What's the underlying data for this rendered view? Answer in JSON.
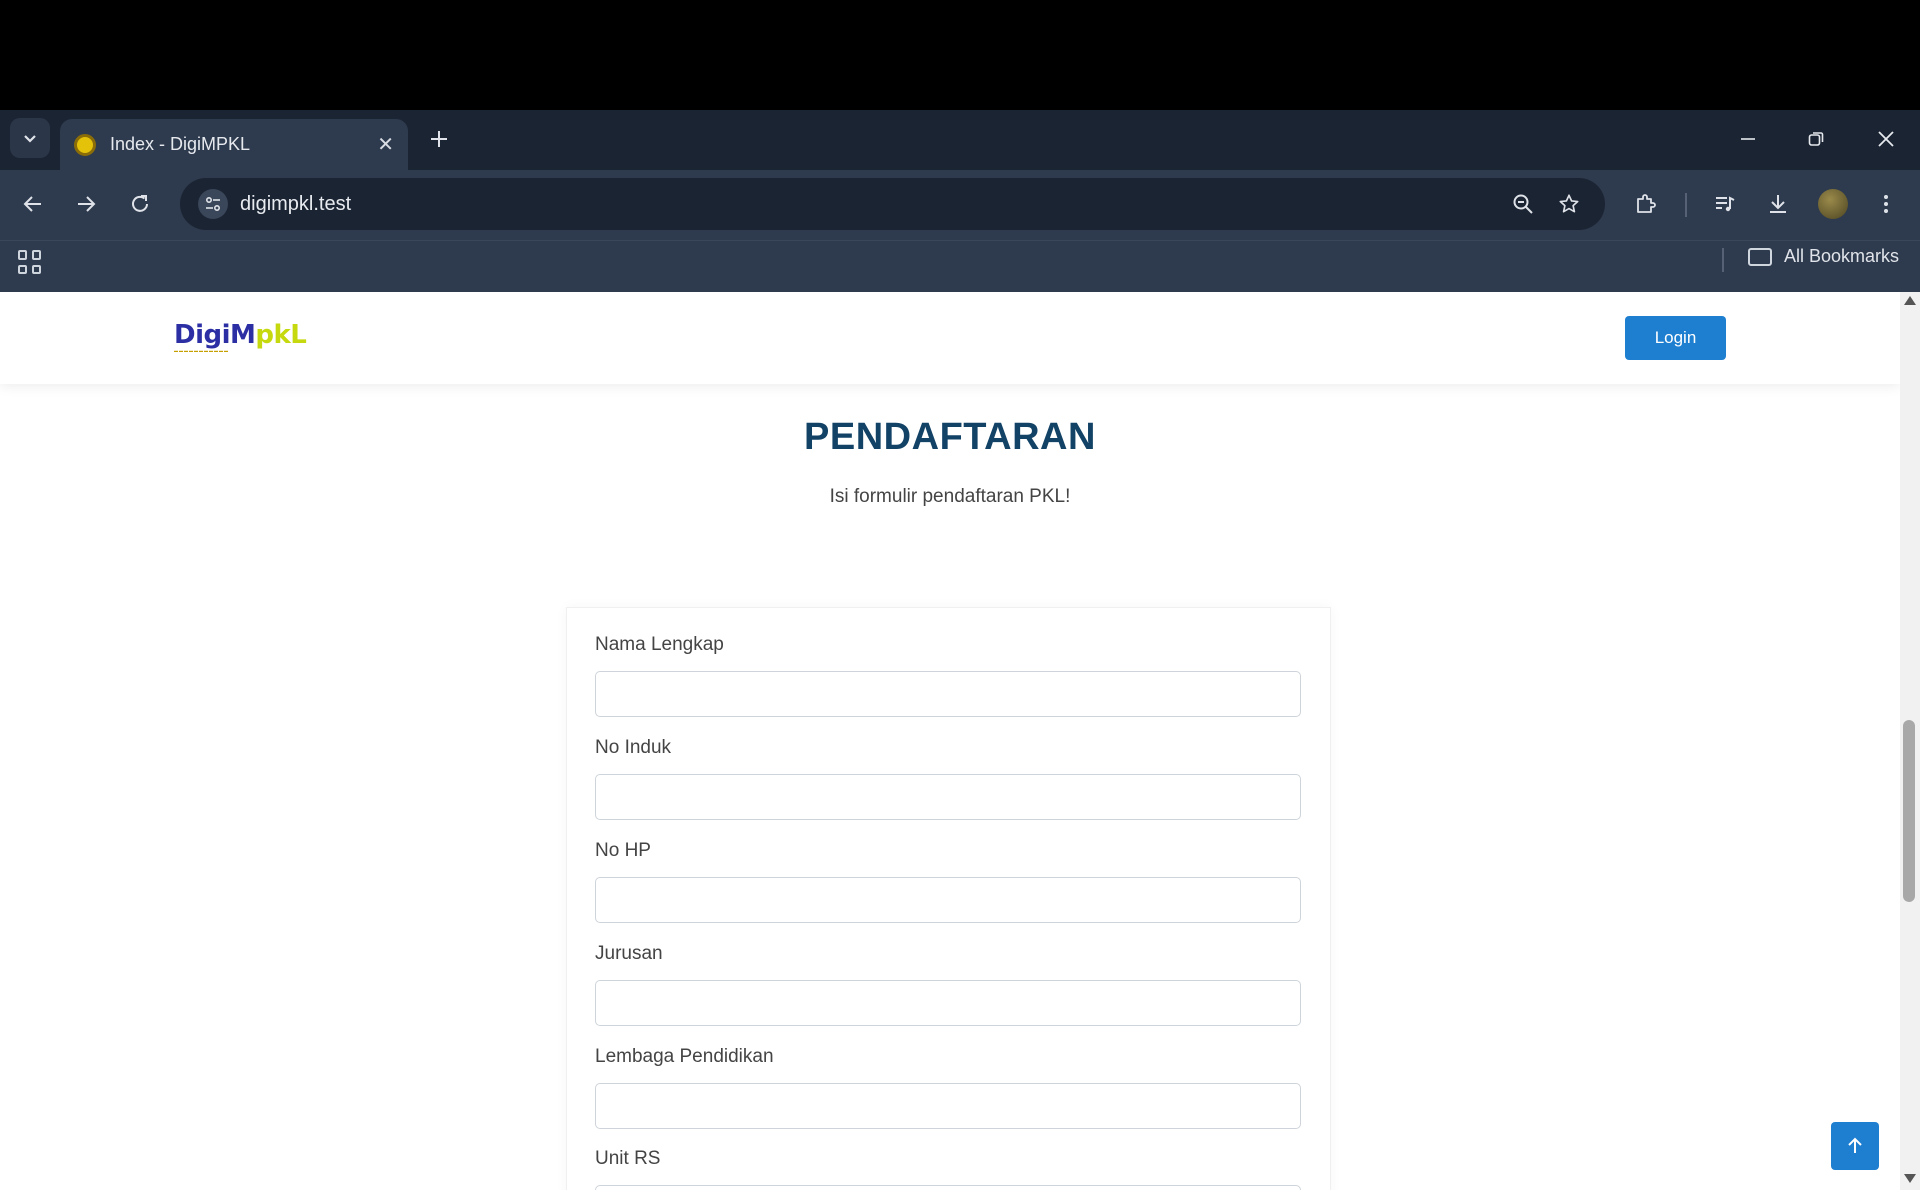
{
  "browser": {
    "tab_title": "Index - DigiMPKL",
    "url": "digimpkl.test",
    "all_bookmarks_label": "All Bookmarks"
  },
  "navbar": {
    "logo_digi": "Digi",
    "logo_m": "M",
    "logo_pkl": "pkL",
    "login_label": "Login"
  },
  "section": {
    "title": "PENDAFTARAN",
    "subtitle": "Isi formulir pendaftaran PKL!"
  },
  "form": {
    "fields": [
      {
        "label": "Nama Lengkap",
        "value": ""
      },
      {
        "label": "No Induk",
        "value": ""
      },
      {
        "label": "No HP",
        "value": ""
      },
      {
        "label": "Jurusan",
        "value": ""
      },
      {
        "label": "Lembaga Pendidikan",
        "value": ""
      },
      {
        "label": "Unit RS",
        "value": ""
      }
    ]
  },
  "colors": {
    "accent": "#1e7fd0",
    "title": "#124265",
    "chrome_dark": "#1b2433",
    "chrome": "#2e3a4d"
  },
  "icons": [
    "tab-list-icon",
    "favicon-icon",
    "close-icon",
    "plus-icon",
    "minimize-icon",
    "restore-icon",
    "window-close-icon",
    "back-icon",
    "forward-icon",
    "reload-icon",
    "site-info-icon",
    "zoom-out-icon",
    "star-icon",
    "extensions-icon",
    "media-icon",
    "download-icon",
    "apps-icon",
    "folder-icon",
    "arrow-up-icon"
  ]
}
